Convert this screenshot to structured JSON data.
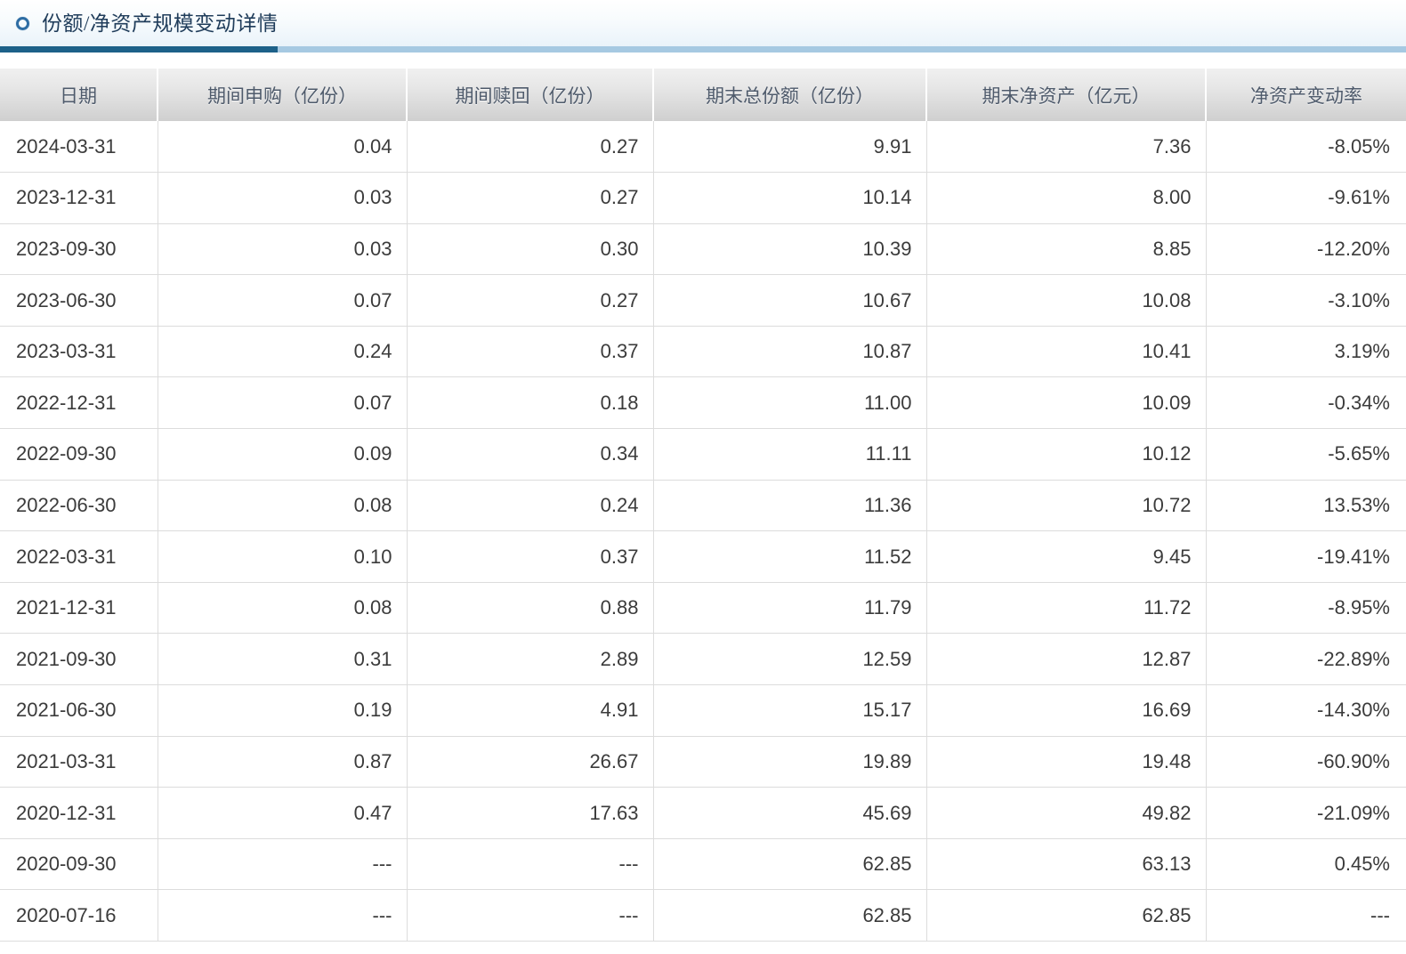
{
  "panel": {
    "title": "份额/净资产规模变动详情",
    "icon": "ring-icon",
    "accent_color": "#1d6189",
    "accent_track_color": "#a6c9e2",
    "title_color": "#1f3c5a"
  },
  "table": {
    "columns": [
      {
        "key": "date",
        "label": "日期"
      },
      {
        "key": "sub",
        "label": "期间申购（亿份）"
      },
      {
        "key": "red",
        "label": "期间赎回（亿份）"
      },
      {
        "key": "tot",
        "label": "期末总份额（亿份）"
      },
      {
        "key": "nav",
        "label": "期末净资产（亿元）"
      },
      {
        "key": "rate",
        "label": "净资产变动率"
      }
    ],
    "rows": [
      {
        "date": "2024-03-31",
        "sub": "0.04",
        "red": "0.27",
        "tot": "9.91",
        "nav": "7.36",
        "rate": "-8.05%"
      },
      {
        "date": "2023-12-31",
        "sub": "0.03",
        "red": "0.27",
        "tot": "10.14",
        "nav": "8.00",
        "rate": "-9.61%"
      },
      {
        "date": "2023-09-30",
        "sub": "0.03",
        "red": "0.30",
        "tot": "10.39",
        "nav": "8.85",
        "rate": "-12.20%"
      },
      {
        "date": "2023-06-30",
        "sub": "0.07",
        "red": "0.27",
        "tot": "10.67",
        "nav": "10.08",
        "rate": "-3.10%"
      },
      {
        "date": "2023-03-31",
        "sub": "0.24",
        "red": "0.37",
        "tot": "10.87",
        "nav": "10.41",
        "rate": "3.19%"
      },
      {
        "date": "2022-12-31",
        "sub": "0.07",
        "red": "0.18",
        "tot": "11.00",
        "nav": "10.09",
        "rate": "-0.34%"
      },
      {
        "date": "2022-09-30",
        "sub": "0.09",
        "red": "0.34",
        "tot": "11.11",
        "nav": "10.12",
        "rate": "-5.65%"
      },
      {
        "date": "2022-06-30",
        "sub": "0.08",
        "red": "0.24",
        "tot": "11.36",
        "nav": "10.72",
        "rate": "13.53%"
      },
      {
        "date": "2022-03-31",
        "sub": "0.10",
        "red": "0.37",
        "tot": "11.52",
        "nav": "9.45",
        "rate": "-19.41%"
      },
      {
        "date": "2021-12-31",
        "sub": "0.08",
        "red": "0.88",
        "tot": "11.79",
        "nav": "11.72",
        "rate": "-8.95%"
      },
      {
        "date": "2021-09-30",
        "sub": "0.31",
        "red": "2.89",
        "tot": "12.59",
        "nav": "12.87",
        "rate": "-22.89%"
      },
      {
        "date": "2021-06-30",
        "sub": "0.19",
        "red": "4.91",
        "tot": "15.17",
        "nav": "16.69",
        "rate": "-14.30%"
      },
      {
        "date": "2021-03-31",
        "sub": "0.87",
        "red": "26.67",
        "tot": "19.89",
        "nav": "19.48",
        "rate": "-60.90%"
      },
      {
        "date": "2020-12-31",
        "sub": "0.47",
        "red": "17.63",
        "tot": "45.69",
        "nav": "49.82",
        "rate": "-21.09%"
      },
      {
        "date": "2020-09-30",
        "sub": "---",
        "red": "---",
        "tot": "62.85",
        "nav": "63.13",
        "rate": "0.45%"
      },
      {
        "date": "2020-07-16",
        "sub": "---",
        "red": "---",
        "tot": "62.85",
        "nav": "62.85",
        "rate": "---"
      }
    ]
  }
}
